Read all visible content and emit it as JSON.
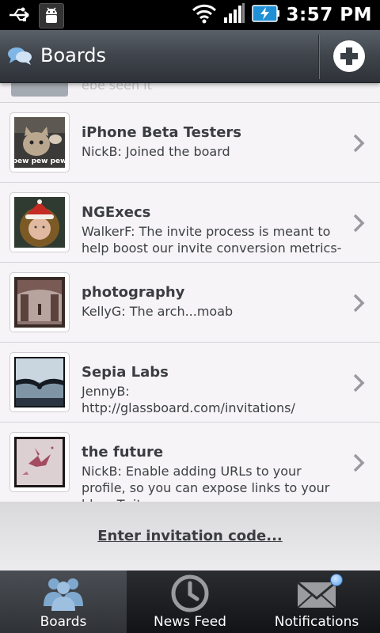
{
  "status_bar": {
    "time": "3:57 PM"
  },
  "header": {
    "title": "Boards"
  },
  "partial_row": {
    "text": "ebe seen it"
  },
  "boards": [
    {
      "name": "iPhone Beta Testers",
      "message": "NickB: Joined the board",
      "thumbnail_caption": "pew pew pew"
    },
    {
      "name": "NGExecs",
      "message": "WalkerF: The invite process is meant to help boost our invite conversion metrics- ..."
    },
    {
      "name": "photography",
      "message": "KellyG: The arch...moab"
    },
    {
      "name": "Sepia Labs",
      "message": "JennyB: http://glassboard.com/invitations/"
    },
    {
      "name": "the future",
      "message": "NickB: Enable adding URLs to your profile, so you can expose links to your blog, Twit..."
    }
  ],
  "invitation": {
    "label": "Enter invitation code..."
  },
  "tabs": [
    {
      "label": "Boards",
      "icon": "people-icon",
      "active": true
    },
    {
      "label": "News Feed",
      "icon": "clock-icon",
      "active": false
    },
    {
      "label": "Notifications",
      "icon": "envelope-icon",
      "active": false,
      "has_badge": true
    }
  ],
  "colors": {
    "title_bar": "#40454c",
    "list_background": "#f6f4f6",
    "tab_bar": "#1a1b1e",
    "badge": "#5aa0e6"
  }
}
